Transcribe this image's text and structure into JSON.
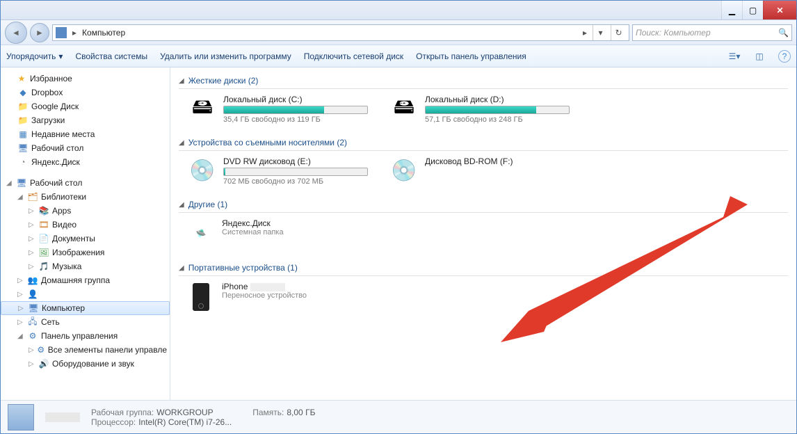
{
  "titlebar": {
    "min": "▁",
    "max": "▢",
    "close": "✕"
  },
  "nav": {
    "back_glyph": "◄",
    "fwd_glyph": "►",
    "addr_label": "Компьютер",
    "addr_chevron": "▸",
    "addr_drop": "▾",
    "addr_refresh": "↻",
    "search_placeholder": "Поиск: Компьютер",
    "search_glyph": "🔍"
  },
  "toolbar": {
    "organize": "Упорядочить",
    "drop": "▾",
    "properties": "Свойства системы",
    "uninstall": "Удалить или изменить программу",
    "map_drive": "Подключить сетевой диск",
    "control_panel": "Открыть панель управления",
    "view_drop": "▾",
    "help_glyph": "?"
  },
  "tree": {
    "favorites": "Избранное",
    "fav_items": [
      "Dropbox",
      "Google Диск",
      "Загрузки",
      "Недавние места",
      "Рабочий стол",
      "Яндекс.Диск"
    ],
    "desktop": "Рабочий стол",
    "libraries": "Библиотеки",
    "lib_items": [
      "Apps",
      "Видео",
      "Документы",
      "Изображения",
      "Музыка"
    ],
    "homegroup": "Домашняя группа",
    "user_hidden": "",
    "computer": "Компьютер",
    "network": "Сеть",
    "control_panel": "Панель управления",
    "cp_all": "Все элементы панели управле",
    "cp_hw": "Оборудование и звук"
  },
  "sections": {
    "hard_drives": {
      "title": "Жесткие диски (2)",
      "items": [
        {
          "name": "Локальный диск (C:)",
          "free": "35,4 ГБ свободно из 119 ГБ",
          "fill_pct": 70
        },
        {
          "name": "Локальный диск (D:)",
          "free": "57,1 ГБ свободно из 248 ГБ",
          "fill_pct": 77
        }
      ]
    },
    "removable": {
      "title": "Устройства со съемными носителями (2)",
      "items": [
        {
          "name": "DVD RW дисковод (E:)",
          "free": "702 МБ свободно из 702 МБ",
          "fill_pct": 1
        },
        {
          "name": "Дисковод BD-ROM (F:)",
          "free": ""
        }
      ]
    },
    "other": {
      "title": "Другие (1)",
      "item": {
        "name": "Яндекс.Диск",
        "sub": "Системная папка"
      }
    },
    "portable": {
      "title": "Портативные устройства (1)",
      "item": {
        "name": "iPhone",
        "sub": "Переносное устройство"
      }
    }
  },
  "status": {
    "workgroup_label": "Рабочая группа:",
    "workgroup_value": "WORKGROUP",
    "cpu_label": "Процессор:",
    "cpu_value": "Intel(R) Core(TM) i7-26...",
    "mem_label": "Память:",
    "mem_value": "8,00 ГБ"
  }
}
